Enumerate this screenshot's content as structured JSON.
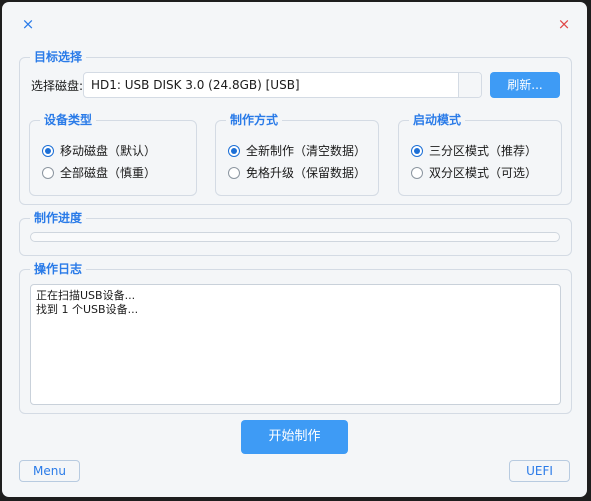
{
  "titlebar": {
    "about_icon": "×",
    "close_icon": "×"
  },
  "target": {
    "title": "目标选择",
    "disk_label": "选择磁盘:",
    "disk_value": "HD1: USB DISK 3.0 (24.8GB) [USB]",
    "refresh_label": "刷新..."
  },
  "device_type": {
    "title": "设备类型",
    "options": [
      {
        "label": "移动磁盘（默认）",
        "selected": true
      },
      {
        "label": "全部磁盘（慎重）",
        "selected": false
      }
    ]
  },
  "make_mode": {
    "title": "制作方式",
    "options": [
      {
        "label": "全新制作（清空数据）",
        "selected": true
      },
      {
        "label": "免格升级（保留数据）",
        "selected": false
      }
    ]
  },
  "boot_mode": {
    "title": "启动模式",
    "options": [
      {
        "label": "三分区模式（推荐）",
        "selected": true
      },
      {
        "label": "双分区模式（可选）",
        "selected": false
      }
    ]
  },
  "progress": {
    "title": "制作进度",
    "value": 0
  },
  "log": {
    "title": "操作日志",
    "lines": [
      "正在扫描USB设备...",
      "找到 1 个USB设备..."
    ]
  },
  "actions": {
    "start_label": "开始制作",
    "menu_label": "Menu",
    "uefi_label": "UEFI"
  },
  "colors": {
    "accent": "#3e9bf5",
    "title_blue": "#2a7be8",
    "close_red": "#e04848"
  }
}
